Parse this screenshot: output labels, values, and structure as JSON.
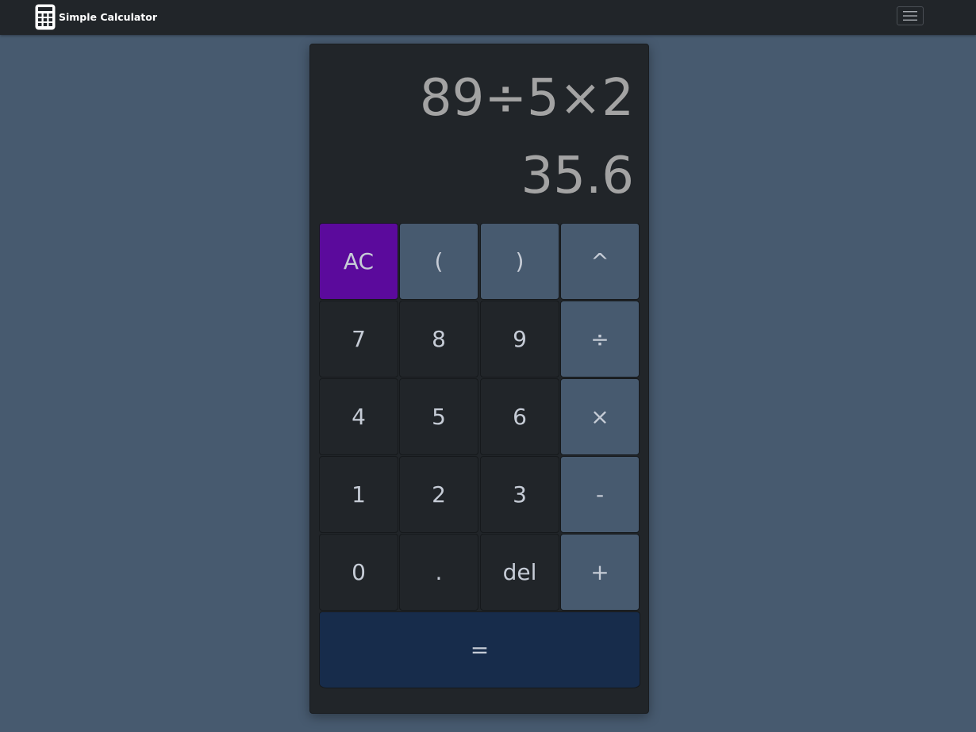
{
  "navbar": {
    "brand_text": "Simple Calculator",
    "brand_icon": "calculator-icon",
    "menu_icon": "hamburger-menu-icon"
  },
  "display": {
    "expression": "89÷5×2",
    "result": "35.6"
  },
  "keys": {
    "ac": "AC",
    "lparen": "(",
    "rparen": ")",
    "power": "^",
    "seven": "7",
    "eight": "8",
    "nine": "9",
    "divide": "÷",
    "four": "4",
    "five": "5",
    "six": "6",
    "multiply": "×",
    "one": "1",
    "two": "2",
    "three": "3",
    "minus": "-",
    "zero": "0",
    "dot": ".",
    "del": "del",
    "plus": "+",
    "equals": "="
  },
  "colors": {
    "page_background": "#475a6f",
    "navbar_background": "#212529",
    "calculator_background": "#212529",
    "ac_key": "#5b0a9c",
    "operator_key": "#475a6f",
    "equals_key": "#172c4b",
    "display_text": "#a3a3a3",
    "key_text": "#c6ccd6"
  }
}
